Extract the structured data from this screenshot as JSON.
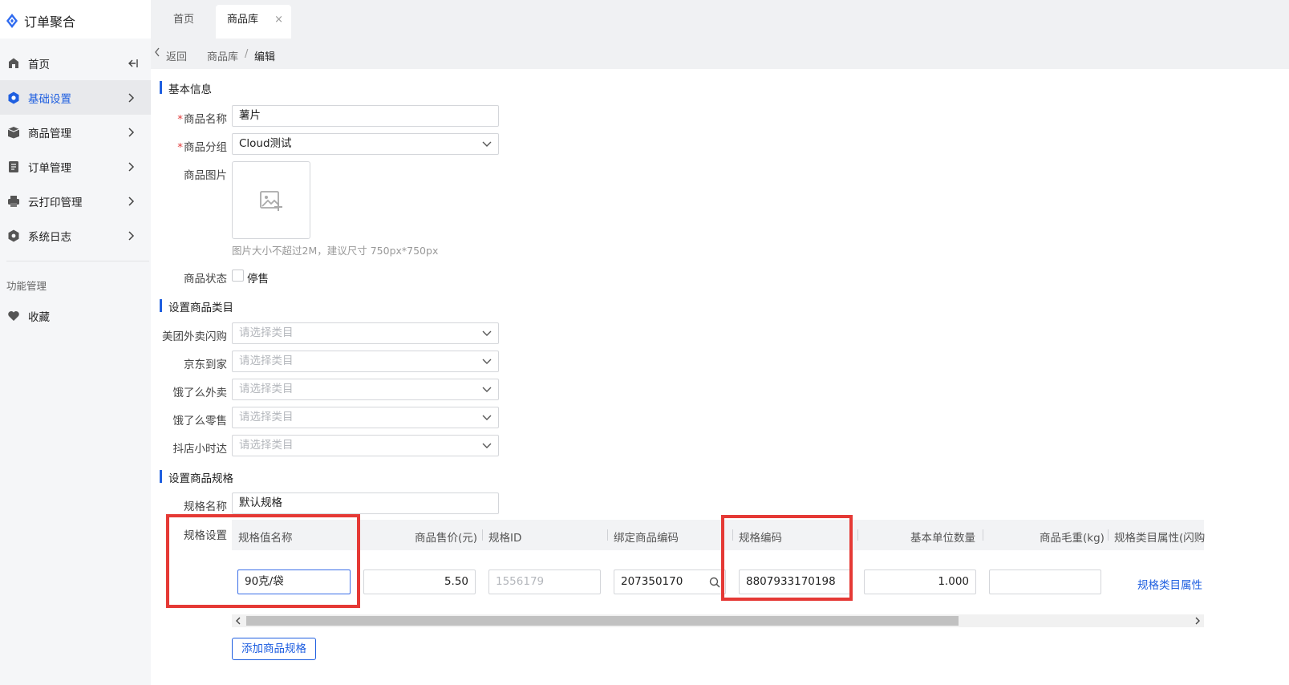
{
  "app": {
    "title": "订单聚合",
    "accent_color": "#1f5fe0",
    "highlight_color": "#e53935"
  },
  "tabs": [
    {
      "label": "首页"
    },
    {
      "label": "商品库",
      "close": "×"
    }
  ],
  "sidebar": {
    "items": [
      {
        "label": "首页",
        "icon": "home-icon"
      },
      {
        "label": "基础设置",
        "icon": "settings-hex-icon"
      },
      {
        "label": "商品管理",
        "icon": "box-icon"
      },
      {
        "label": "订单管理",
        "icon": "document-icon"
      },
      {
        "label": "云打印管理",
        "icon": "printer-icon"
      },
      {
        "label": "系统日志",
        "icon": "log-hex-icon"
      }
    ],
    "section_title": "功能管理",
    "favorites": {
      "label": "收藏",
      "icon": "heart-icon"
    }
  },
  "breadcrumb": {
    "back": "返回",
    "parent": "商品库",
    "separator": "/",
    "current": "编辑"
  },
  "basic": {
    "title": "基本信息",
    "name_label": "商品名称",
    "name_value": "薯片",
    "group_label": "商品分组",
    "group_value": "Cloud测试",
    "image_label": "商品图片",
    "image_hint": "图片大小不超过2M，建议尺寸 750px*750px",
    "status_label": "商品状态",
    "status_option": "停售",
    "required_mark": "*"
  },
  "category": {
    "title": "设置商品类目",
    "placeholder": "请选择类目",
    "platforms": [
      "美团外卖闪购",
      "京东到家",
      "饿了么外卖",
      "饿了么零售",
      "抖店小时达"
    ]
  },
  "spec": {
    "title": "设置商品规格",
    "name_label": "规格名称",
    "name_value": "默认规格",
    "settings_label": "规格设置",
    "columns": [
      "规格值名称",
      "商品售价(元)",
      "规格ID",
      "绑定商品编码",
      "规格编码",
      "基本单位数量",
      "商品毛重(kg)",
      "规格类目属性(闪购"
    ],
    "row": {
      "value_name": "90克/袋",
      "price": "5.50",
      "spec_id": "1556179",
      "bind_code": "207350170",
      "spec_code": "8807933170198",
      "unit_qty": "1.000",
      "weight": "",
      "attr_link": "规格类目属性"
    },
    "add_button": "添加商品规格"
  }
}
